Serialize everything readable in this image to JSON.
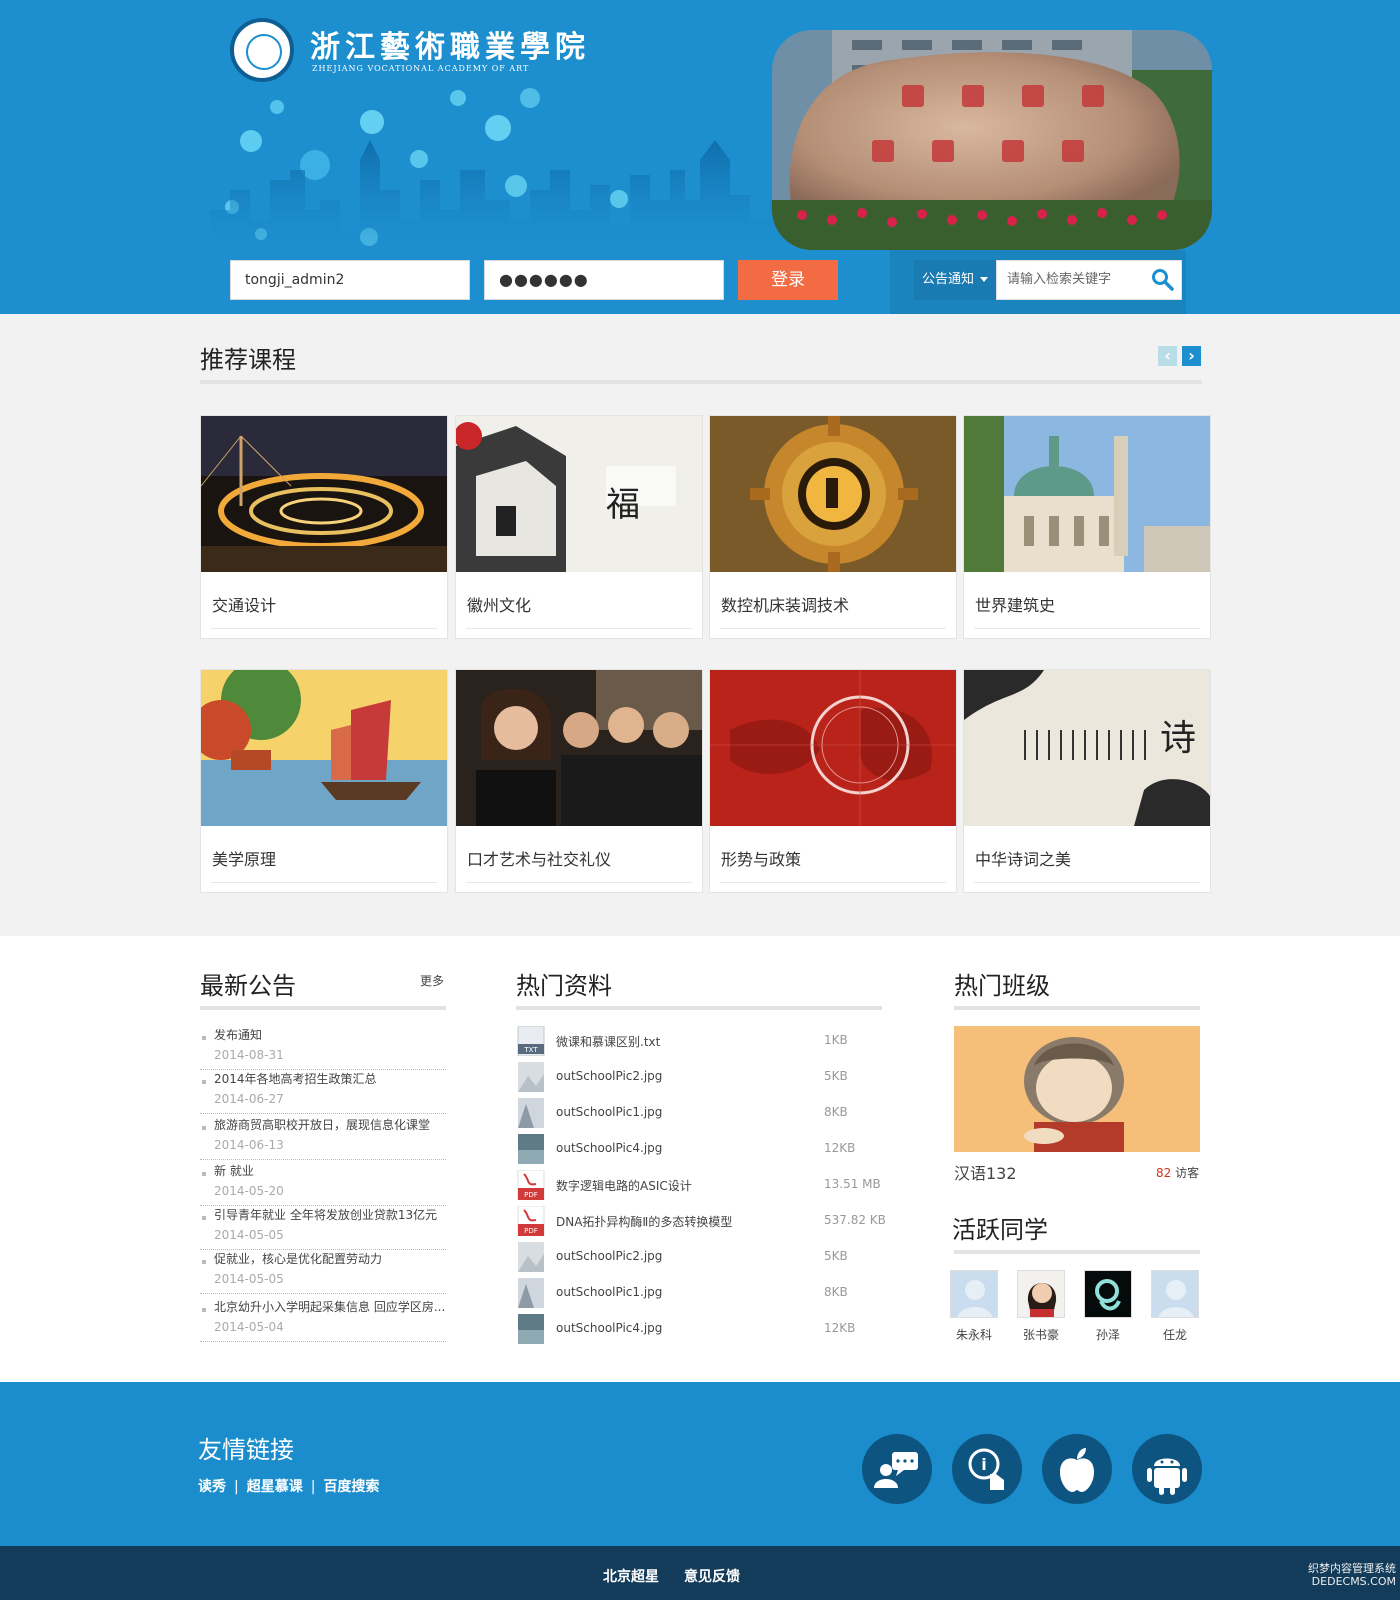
{
  "header": {
    "logo_cn": "浙江藝術職業學院",
    "logo_en": "ZHEJIANG VOCATIONAL ACADEMY OF ART",
    "username_value": "tongji_admin2",
    "password_value": "●●●●●●",
    "login_label": "登录",
    "search_category": "公告通知",
    "search_placeholder": "请输入检索关键字"
  },
  "courses": {
    "title": "推荐课程",
    "items": [
      {
        "name": "交通设计"
      },
      {
        "name": "徽州文化"
      },
      {
        "name": "数控机床装调技术"
      },
      {
        "name": "世界建筑史"
      },
      {
        "name": "美学原理"
      },
      {
        "name": "口才艺术与社交礼仪"
      },
      {
        "name": "形势与政策"
      },
      {
        "name": "中华诗词之美"
      }
    ]
  },
  "notices": {
    "title": "最新公告",
    "more": "更多",
    "items": [
      {
        "title": "发布通知",
        "date": "2014-08-31"
      },
      {
        "title": "2014年各地高考招生政策汇总",
        "date": "2014-06-27"
      },
      {
        "title": "旅游商贸高职校开放日，展现信息化课堂",
        "date": "2014-06-13"
      },
      {
        "title": "新 就业",
        "date": "2014-05-20"
      },
      {
        "title": "引导青年就业 全年将发放创业贷款13亿元",
        "date": "2014-05-05"
      },
      {
        "title": "促就业，核心是优化配置劳动力",
        "date": "2014-05-05"
      },
      {
        "title": "北京幼升小入学明起采集信息 回应学区房...",
        "date": "2014-05-04"
      }
    ]
  },
  "materials": {
    "title": "热门资料",
    "items": [
      {
        "name": "微课和慕课区别.txt",
        "size": "1KB",
        "icon": "txt-file-icon"
      },
      {
        "name": "outSchoolPic2.jpg",
        "size": "5KB",
        "icon": "image-file-icon"
      },
      {
        "name": "outSchoolPic1.jpg",
        "size": "8KB",
        "icon": "image-file-icon"
      },
      {
        "name": "outSchoolPic4.jpg",
        "size": "12KB",
        "icon": "image-file-icon"
      },
      {
        "name": "数字逻辑电路的ASIC设计",
        "size": "13.51 MB",
        "icon": "pdf-file-icon"
      },
      {
        "name": "DNA拓扑异构酶Ⅱ的多态转换模型",
        "size": "537.82 KB",
        "icon": "pdf-file-icon"
      },
      {
        "name": "outSchoolPic2.jpg",
        "size": "5KB",
        "icon": "image-file-icon"
      },
      {
        "name": "outSchoolPic1.jpg",
        "size": "8KB",
        "icon": "image-file-icon"
      },
      {
        "name": "outSchoolPic4.jpg",
        "size": "12KB",
        "icon": "image-file-icon"
      }
    ],
    "txt_tag": "TXT",
    "pdf_tag": "PDF"
  },
  "classes": {
    "title": "热门班级",
    "class_name": "汉语132",
    "visitor_count": "82",
    "visitor_label": "访客"
  },
  "students": {
    "title": "活跃同学",
    "items": [
      {
        "name": "朱永科"
      },
      {
        "name": "张书豪"
      },
      {
        "name": "孙泽"
      },
      {
        "name": "任龙"
      }
    ]
  },
  "footer": {
    "links_title": "友情链接",
    "links": [
      "读秀",
      "超星慕课",
      "百度搜索"
    ],
    "separator": "|",
    "app_icons": [
      "chat-support-icon",
      "touch-info-icon",
      "apple-icon",
      "android-icon"
    ],
    "bottom_links": [
      "北京超星",
      "意见反馈"
    ],
    "watermark_line1": "织梦内容管理系统",
    "watermark_line2": "DEDECMS.COM"
  },
  "colors": {
    "brand_blue": "#1d8fcf",
    "login_orange": "#f26b43",
    "footer_dark": "#123c5a",
    "visitor_red": "#d0311e"
  }
}
